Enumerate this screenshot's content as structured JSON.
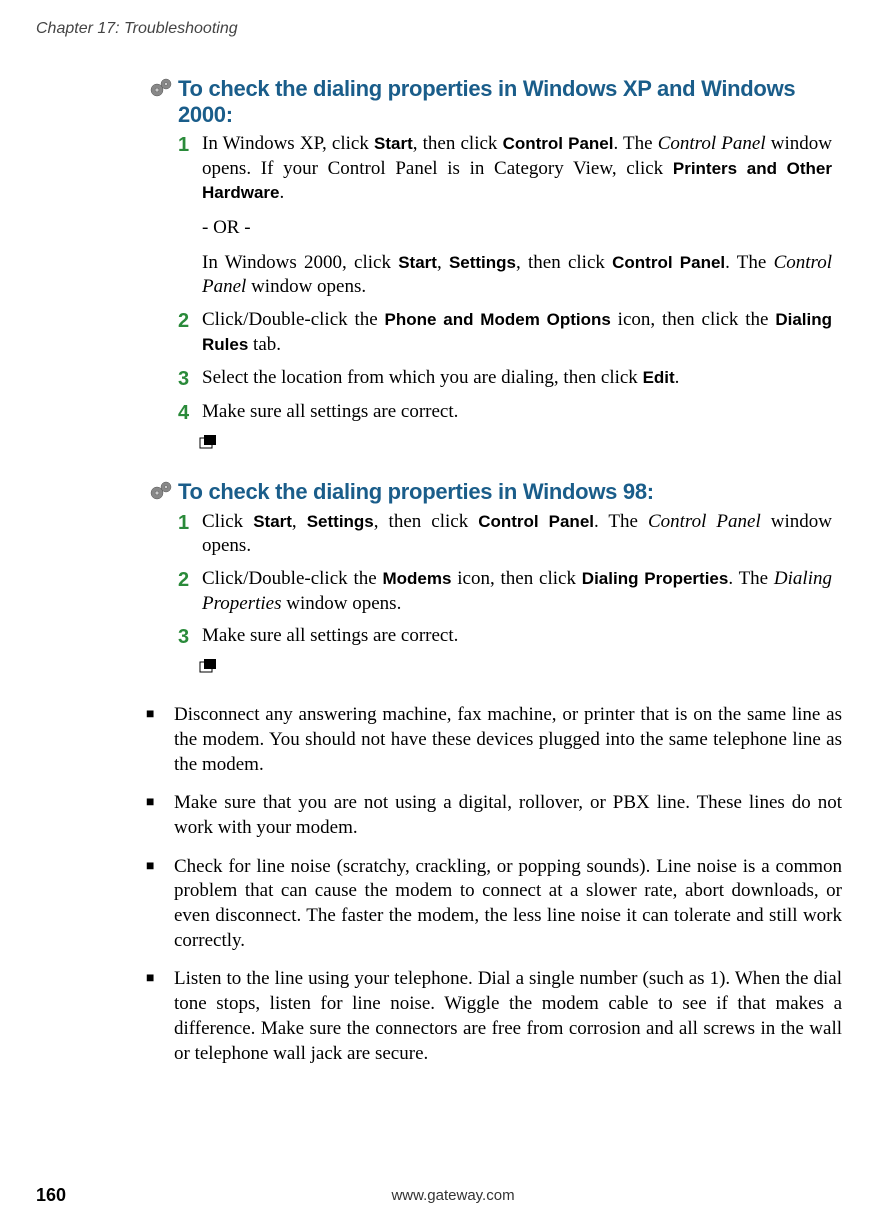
{
  "header": {
    "chapter": "Chapter 17: Troubleshooting"
  },
  "sections": [
    {
      "heading": "To check the dialing properties in Windows XP and Windows 2000:",
      "steps": [
        {
          "num": "1",
          "parts": {
            "p1a": "In Windows XP, click ",
            "p1b": "Start",
            "p1c": ", then click ",
            "p1d": "Control Panel",
            "p1e": ". The ",
            "p1f": "Control Panel",
            "p1g": " window opens. If your Control Panel is in Category View, click ",
            "p1h": "Printers and Other Hardware",
            "p1i": ".",
            "or": "- OR -",
            "p2a": "In Windows 2000, click ",
            "p2b": "Start",
            "p2c": ", ",
            "p2d": "Settings",
            "p2e": ", then click ",
            "p2f": "Control Panel",
            "p2g": ". The ",
            "p2h": "Control Panel",
            "p2i": " window opens."
          }
        },
        {
          "num": "2",
          "parts": {
            "a": "Click/Double-click the ",
            "b": "Phone and Modem Options",
            "c": " icon, then click the ",
            "d": "Dialing Rules",
            "e": " tab."
          }
        },
        {
          "num": "3",
          "parts": {
            "a": "Select the location from which you are dialing, then click ",
            "b": "Edit",
            "c": "."
          }
        },
        {
          "num": "4",
          "parts": {
            "a": "Make sure all settings are correct."
          }
        }
      ]
    },
    {
      "heading": "To check the dialing properties in Windows 98:",
      "steps": [
        {
          "num": "1",
          "parts": {
            "a": "Click ",
            "b": "Start",
            "c": ", ",
            "d": "Settings",
            "e": ", then click ",
            "f": "Control Panel",
            "g": ". The ",
            "h": "Control Panel",
            "i": " window opens."
          }
        },
        {
          "num": "2",
          "parts": {
            "a": "Click/Double-click the ",
            "b": "Modems",
            "c": " icon, then click ",
            "d": "Dialing Properties",
            "e": ". The ",
            "f": "Dialing Properties",
            "g": " window opens."
          }
        },
        {
          "num": "3",
          "parts": {
            "a": "Make sure all settings are correct."
          }
        }
      ]
    }
  ],
  "bullets": [
    "Disconnect any answering machine, fax machine, or printer that is on the same line as the modem. You should not have these devices plugged into the same telephone line as the modem.",
    "Make sure that you are not using a digital, rollover, or PBX line. These lines do not work with your modem.",
    "Check for line noise (scratchy, crackling, or popping sounds). Line noise is a common problem that can cause the modem to connect at a slower rate, abort downloads, or even disconnect. The faster the modem, the less line noise it can tolerate and still work correctly.",
    "Listen to the line using your telephone. Dial a single number (such as 1). When the dial tone stops, listen for line noise. Wiggle the modem cable to see if that makes a difference. Make sure the connectors are free from corrosion and all screws in the wall or telephone wall jack are secure."
  ],
  "footer": {
    "page": "160",
    "url": "www.gateway.com"
  }
}
